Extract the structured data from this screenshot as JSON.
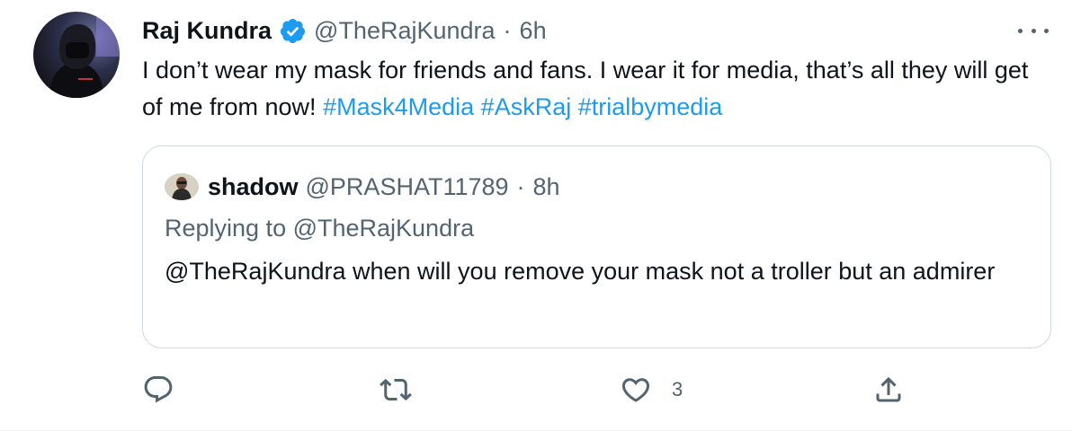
{
  "tweet": {
    "display_name": "Raj Kundra",
    "handle": "@TheRajKundra",
    "separator": "·",
    "time": "6h",
    "text_plain": "I don’t wear my mask for friends and fans. I wear it for media, that’s all they will get of me from now! ",
    "hashtags": [
      "#Mask4Media",
      "#AskRaj",
      "#trialbymedia"
    ],
    "verified": true,
    "more_icon": "more-horizontal-icon"
  },
  "quoted_tweet": {
    "display_name": "shadow",
    "handle": "@PRASHAT11789",
    "separator": "·",
    "time": "8h",
    "replying_to": "Replying to @TheRajKundra",
    "text": "@TheRajKundra when will you remove your mask not a troller but an admirer"
  },
  "actions": {
    "reply": {
      "icon": "reply-icon",
      "count": ""
    },
    "retweet": {
      "icon": "retweet-icon",
      "count": ""
    },
    "like": {
      "icon": "heart-icon",
      "count": "3"
    },
    "share": {
      "icon": "share-icon",
      "count": ""
    }
  },
  "colors": {
    "text": "#0f1419",
    "secondary": "#536471",
    "accent": "#1d9bf0",
    "border": "#cfd9de"
  }
}
